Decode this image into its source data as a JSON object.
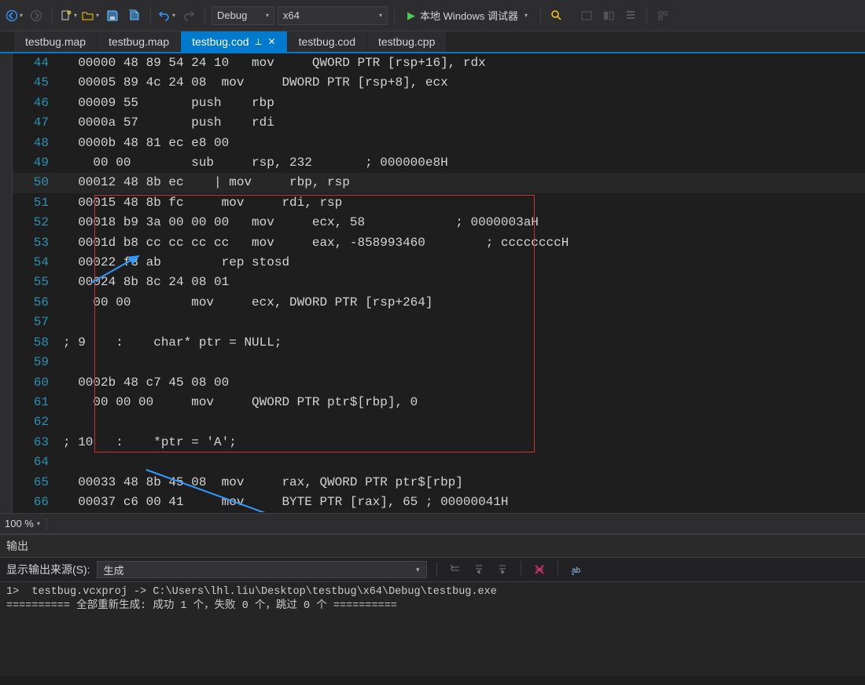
{
  "toolbar": {
    "back_tip": "back",
    "forward_tip": "forward",
    "newfile_tip": "new",
    "open_tip": "open",
    "save_tip": "save",
    "saveall_tip": "save-all",
    "undo_tip": "undo",
    "redo_tip": "redo",
    "config": "Debug",
    "platform": "x64",
    "run_label": "本地 Windows 调试器"
  },
  "tabs": [
    {
      "label": "testbug.map",
      "active": false
    },
    {
      "label": "testbug.map",
      "active": false
    },
    {
      "label": "testbug.cod",
      "active": true
    },
    {
      "label": "testbug.cod",
      "active": false
    },
    {
      "label": "testbug.cpp",
      "active": false
    }
  ],
  "code_lines": [
    {
      "n": 44,
      "t": "  00000 48 89 54 24 10   mov     QWORD PTR [rsp+16], rdx"
    },
    {
      "n": 45,
      "t": "  00005 89 4c 24 08  mov     DWORD PTR [rsp+8], ecx"
    },
    {
      "n": 46,
      "t": "  00009 55       push    rbp"
    },
    {
      "n": 47,
      "t": "  0000a 57       push    rdi"
    },
    {
      "n": 48,
      "t": "  0000b 48 81 ec e8 00"
    },
    {
      "n": 49,
      "t": "    00 00        sub     rsp, 232       ; 000000e8H"
    },
    {
      "n": 50,
      "t": "  00012 48 8b ec    | mov     rbp, rsp",
      "hl": true
    },
    {
      "n": 51,
      "t": "  00015 48 8b fc     mov     rdi, rsp"
    },
    {
      "n": 52,
      "t": "  00018 b9 3a 00 00 00   mov     ecx, 58            ; 0000003aH"
    },
    {
      "n": 53,
      "t": "  0001d b8 cc cc cc cc   mov     eax, -858993460        ; ccccccccH"
    },
    {
      "n": 54,
      "t": "  00022 f3 ab        rep stosd"
    },
    {
      "n": 55,
      "t": "  00024 8b 8c 24 08 01"
    },
    {
      "n": 56,
      "t": "    00 00        mov     ecx, DWORD PTR [rsp+264]"
    },
    {
      "n": 57,
      "t": ""
    },
    {
      "n": 58,
      "t": "; 9    :    char* ptr = NULL;"
    },
    {
      "n": 59,
      "t": ""
    },
    {
      "n": 60,
      "t": "  0002b 48 c7 45 08 00"
    },
    {
      "n": 61,
      "t": "    00 00 00     mov     QWORD PTR ptr$[rbp], 0"
    },
    {
      "n": 62,
      "t": ""
    },
    {
      "n": 63,
      "t": "; 10   :    *ptr = 'A';"
    },
    {
      "n": 64,
      "t": ""
    },
    {
      "n": 65,
      "t": "  00033 48 8b 45 08  mov     rax, QWORD PTR ptr$[rbp]"
    },
    {
      "n": 66,
      "t": "  00037 c6 00 41     mov     BYTE PTR [rax], 65 ; 00000041H"
    }
  ],
  "zoom": "100 %",
  "output": {
    "title": "输出",
    "source_label": "显示输出来源(S):",
    "source_value": "生成",
    "lines": [
      "1>  testbug.vcxproj -> C:\\Users\\lhl.liu\\Desktop\\testbug\\x64\\Debug\\testbug.exe",
      "========== 全部重新生成: 成功 1 个，失败 0 个，跳过 0 个 =========="
    ]
  }
}
